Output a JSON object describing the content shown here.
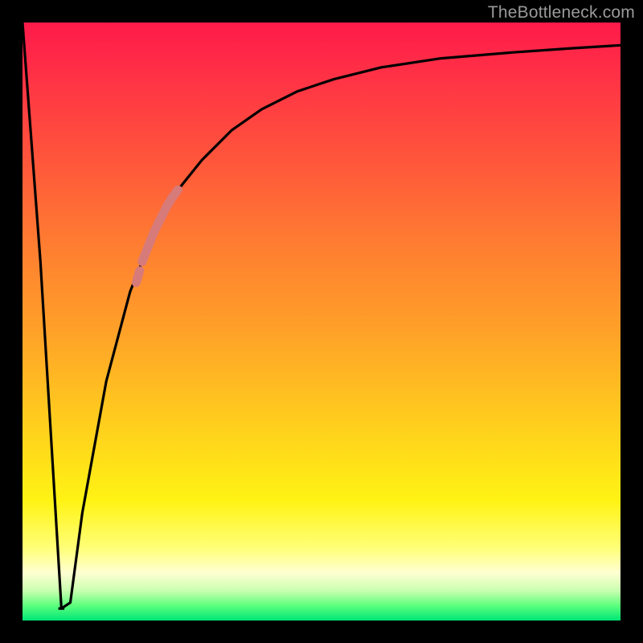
{
  "watermark": "TheBottleneck.com",
  "chart_data": {
    "type": "line",
    "title": "",
    "xlabel": "",
    "ylabel": "",
    "xlim": [
      0,
      100
    ],
    "ylim": [
      0,
      100
    ],
    "grid": false,
    "series": [
      {
        "name": "bottleneck-curve",
        "x": [
          0,
          3,
          6.5,
          8,
          10,
          14,
          18,
          22,
          26,
          30,
          35,
          40,
          46,
          52,
          60,
          70,
          82,
          92,
          100
        ],
        "values": [
          100,
          60,
          2,
          3,
          18,
          40,
          55,
          65,
          72,
          77,
          82,
          85.5,
          88.5,
          90.5,
          92.5,
          94,
          95,
          95.7,
          96.2
        ]
      }
    ],
    "markers": [
      {
        "name": "highlight-segment",
        "color": "#d77a7a",
        "width": 11,
        "x": [
          20,
          21,
          22,
          23,
          24,
          25,
          26
        ],
        "values": [
          60,
          62.5,
          65,
          67,
          69,
          70.7,
          72
        ]
      },
      {
        "name": "highlight-dot",
        "color": "#d77a7a",
        "width": 11,
        "x": [
          19,
          19.6
        ],
        "values": [
          56.5,
          58.5
        ]
      }
    ],
    "notch": {
      "x_range": [
        6,
        7
      ],
      "y": 2
    }
  }
}
